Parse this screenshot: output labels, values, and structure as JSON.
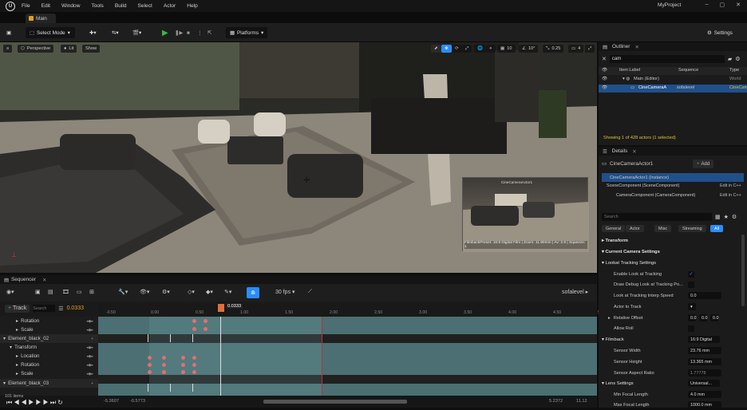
{
  "menu": {
    "items": [
      "File",
      "Edit",
      "Window",
      "Tools",
      "Build",
      "Select",
      "Actor",
      "Help"
    ],
    "project": "MyProject"
  },
  "tab": {
    "label": "Main"
  },
  "toolbar": {
    "select_mode": "Select Mode",
    "platforms": "Platforms",
    "settings": "Settings"
  },
  "viewport": {
    "perspective": "Perspective",
    "lit": "Lit",
    "show": "Show",
    "snap_grid": "10",
    "snap_rot": "10°",
    "snap_scale": "0.25",
    "cam_speed": "4",
    "pip_title": "CineCameraActor1",
    "pip_caption": "FilmbackPreset: 16:9 Digital Film | Zoom: 11.90mm | Av: 2.8 | Squeeze: 1"
  },
  "sequencer": {
    "title": "Sequencer",
    "fps": "30 fps",
    "sequence_name": "sofalevel",
    "add_track": "Track",
    "search_placeholder": "Search",
    "current_time": "0.0333",
    "time_marker": "0.0333",
    "ruler": [
      "-0.50",
      "0.00",
      "0.50",
      "1.00",
      "1.50",
      "2.00",
      "2.50",
      "3.00",
      "3.50",
      "4.00",
      "4.50",
      "5.00"
    ],
    "rows": [
      {
        "label": "Rotation",
        "indent": 2
      },
      {
        "label": "Scale",
        "indent": 2
      },
      {
        "label": "Element_black_02",
        "indent": 0
      },
      {
        "label": "Transform",
        "indent": 1
      },
      {
        "label": "Location",
        "indent": 2
      },
      {
        "label": "Rotation",
        "indent": 2
      },
      {
        "label": "Scale",
        "indent": 2
      },
      {
        "label": "Element_black_03",
        "indent": 0
      }
    ],
    "item_count": "101 items",
    "range_start": "-5.3607",
    "range_start2": "-0.5773",
    "range_end": "5.2372",
    "range_end2": "11.12"
  },
  "outliner": {
    "title": "Outliner",
    "search": "cam",
    "col_label": "Item Label",
    "col_sequence": "Sequence",
    "col_type": "Type",
    "rows": [
      {
        "label": "Main (Editor)",
        "sequence": "",
        "type": "World"
      },
      {
        "label": "CineCameraA",
        "sequence": "sofalevel",
        "type": "CineCam"
      }
    ],
    "status": "Showing 1 of 428 actors (1 selected)"
  },
  "details": {
    "title": "Details",
    "actor": "CineCameraActor1",
    "add": "Add",
    "instance": "CineCameraActor1 (Instance)",
    "components": [
      {
        "label": "SceneComponent (SceneComponent)",
        "action": "Edit in C++"
      },
      {
        "label": "CameraComponent (CameraComponent)",
        "action": "Edit in C++"
      }
    ],
    "search_placeholder": "Search",
    "filters": [
      "General",
      "Actor",
      "Misc",
      "Streaming",
      "All"
    ],
    "sections": {
      "transform": "Transform",
      "current_camera": "Current Camera Settings",
      "lookat": "Lookat Tracking Settings",
      "filmback": "Filmback",
      "lens": "Lens Settings"
    },
    "props": {
      "enable_lookat": "Enable Look at Tracking",
      "draw_debug": "Draw Debug Look at Tracking Po...",
      "interp_speed": "Look at Tracking Interp Speed",
      "interp_speed_val": "0.0",
      "actor_to_track": "Actor to Track",
      "relative_offset": "Relative Offset",
      "offset_vals": [
        "0.0",
        "0.0",
        "0.0"
      ],
      "allow_roll": "Allow Roll",
      "filmback_preset": "16:9 Digital",
      "sensor_width": "Sensor Width",
      "sensor_width_val": "23.76 mm",
      "sensor_height": "Sensor Height",
      "sensor_height_val": "13.365 mm",
      "aspect": "Sensor Aspect Ratio",
      "aspect_val": "1.77778",
      "lens_preset": "Universal...",
      "min_focal": "Min Focal Length",
      "min_focal_val": "4.0 mm",
      "max_focal": "Max Focal Length",
      "max_focal_val": "1000.0 mm"
    }
  },
  "colors": {
    "accent": "#2a8cff",
    "selection": "#20508a",
    "key": "#e07070",
    "play": "#3fb34f",
    "status": "#e0c040"
  }
}
